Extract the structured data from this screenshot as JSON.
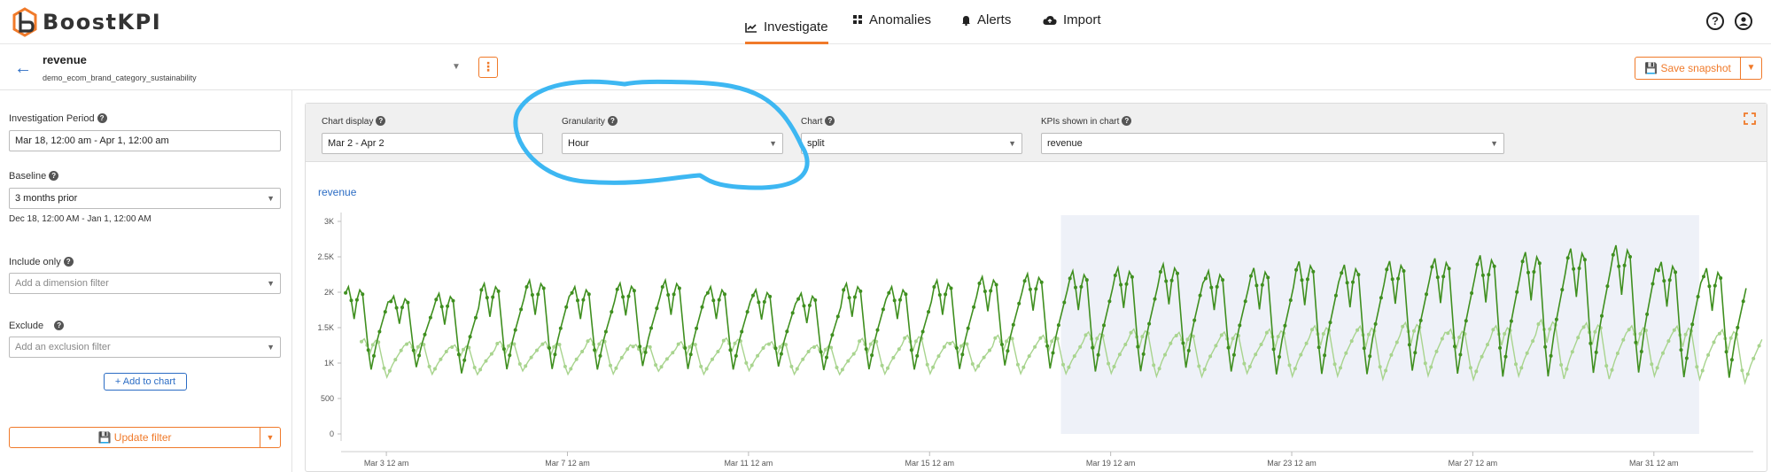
{
  "app": {
    "brand": "BoostKPI",
    "nav": [
      {
        "label": "Investigate",
        "icon": "line-chart-icon",
        "active": true
      },
      {
        "label": "Anomalies",
        "icon": "grid-icon",
        "active": false
      },
      {
        "label": "Alerts",
        "icon": "bell-icon",
        "active": false
      },
      {
        "label": "Import",
        "icon": "cloud-upload-icon",
        "active": false
      }
    ],
    "help_icon": "help-circle-icon",
    "user_icon": "user-circle-icon"
  },
  "subheader": {
    "kpi_name": "revenue",
    "kpi_source": "demo_ecom_brand_category_sustainability",
    "save_snapshot_label": "Save snapshot"
  },
  "sidebar": {
    "period_label": "Investigation Period",
    "period_value": "Mar 18, 12:00 am  - Apr 1, 12:00 am",
    "baseline_label": "Baseline",
    "baseline_value": "3 months prior",
    "baseline_range": "Dec 18, 12:00 AM - Jan 1, 12:00 AM",
    "include_label": "Include only",
    "include_placeholder": "Add a dimension filter",
    "exclude_label": "Exclude",
    "exclude_placeholder": "Add an exclusion filter",
    "add_chart_label": "+ Add to chart",
    "update_filter_label": "Update filter"
  },
  "controls": {
    "chart_display_label": "Chart display",
    "chart_display_value": "Mar 2 - Apr 2",
    "granularity_label": "Granularity",
    "granularity_value": "Hour",
    "chart_label": "Chart",
    "chart_value": "split",
    "kpis_label": "KPIs shown in chart",
    "kpis_value": "revenue"
  },
  "colors": {
    "accent": "#f07a2a",
    "link": "#2b6cc4",
    "current_series": "#3f8f1f",
    "baseline_series": "#a8d48e",
    "highlight": "#eef1f8",
    "annotation": "#3db7f2"
  },
  "chart_data": {
    "type": "line",
    "title": "revenue",
    "ylim": [
      0,
      3000
    ],
    "y_ticks": [
      "0",
      "500",
      "1K",
      "1.5K",
      "2K",
      "2.5K",
      "3K"
    ],
    "x_ticks": [
      "Mar 3 12 am",
      "Mar 7 12 am",
      "Mar 11 12 am",
      "Mar 15 12 am",
      "Mar 19 12 am",
      "Mar 23 12 am",
      "Mar 27 12 am",
      "Mar 31 12 am"
    ],
    "x_range_days": [
      2,
      33
    ],
    "highlight_range_days": [
      17.9,
      32
    ],
    "series": [
      {
        "values_description": "hourly revenue current",
        "daily_peaks": [
          2200,
          2050,
          2100,
          2250,
          2300,
          2200,
          2250,
          2300,
          2200,
          2150,
          2100,
          2250,
          2200,
          2300,
          2350,
          2400,
          2450,
          2500,
          2550,
          2450,
          2500,
          2600,
          2550,
          2600,
          2650,
          2700,
          2750,
          2800,
          2850,
          2600,
          2500
        ],
        "daily_troughs": [
          800,
          850,
          750,
          800,
          800,
          800,
          850,
          800,
          800,
          850,
          800,
          800,
          800,
          800,
          850,
          800,
          750,
          750,
          800,
          750,
          700,
          700,
          700,
          750,
          700,
          650,
          650,
          700,
          700,
          650,
          650
        ]
      },
      {
        "values_description": "hourly revenue baseline",
        "daily_peaks": [
          1400,
          1350,
          1300,
          1350,
          1350,
          1400,
          1300,
          1350,
          1400,
          1350,
          1300,
          1400,
          1450,
          1350,
          1450,
          1450,
          1500,
          1550,
          1500,
          1500,
          1550,
          1600,
          1600,
          1650,
          1550,
          1600,
          1700,
          1650,
          1600,
          1600,
          1550
        ],
        "daily_troughs": [
          750,
          800,
          800,
          850,
          800,
          800,
          850,
          800,
          850,
          800,
          800,
          800,
          800,
          850,
          800,
          800,
          800,
          750,
          750,
          800,
          750,
          750,
          700,
          750,
          700,
          750,
          700,
          700,
          750,
          700,
          650
        ]
      }
    ]
  }
}
